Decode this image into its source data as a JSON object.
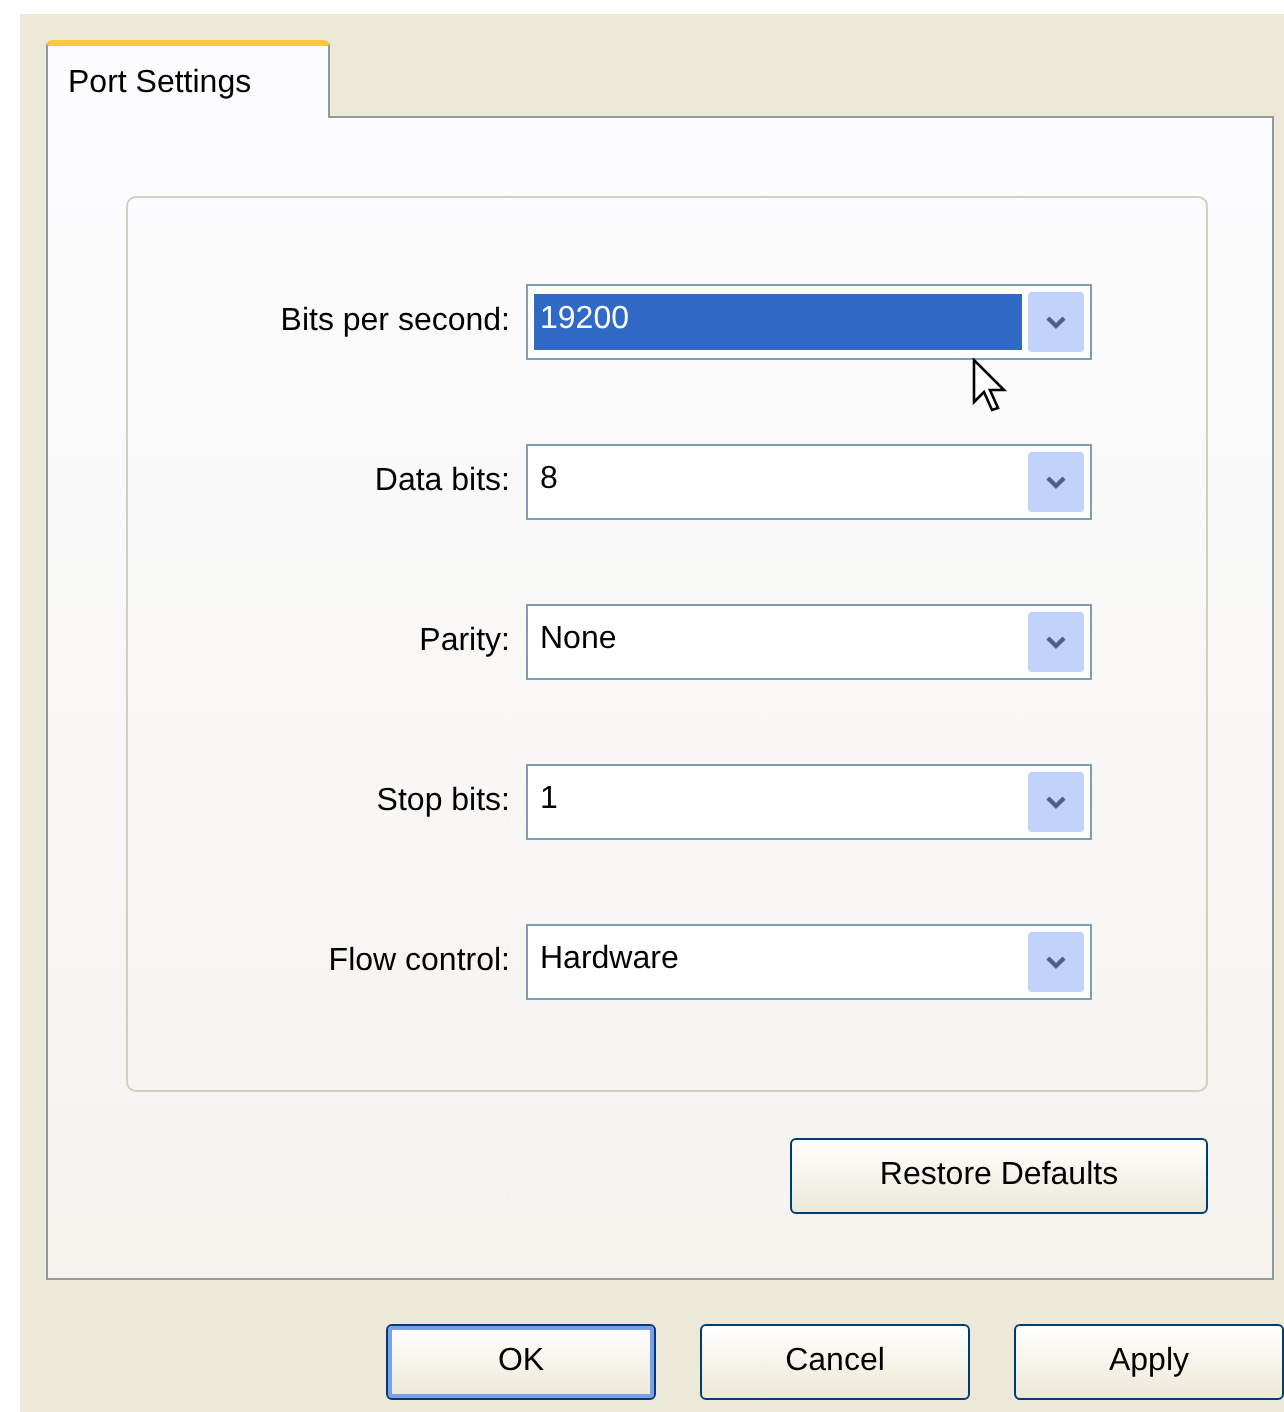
{
  "tabs": [
    {
      "label": "Port Settings",
      "selected": true
    }
  ],
  "fields": [
    {
      "label": "Bits per second:",
      "value": "19200",
      "focused": true
    },
    {
      "label": "Data bits:",
      "value": "8",
      "focused": false
    },
    {
      "label": "Parity:",
      "value": "None",
      "focused": false
    },
    {
      "label": "Stop bits:",
      "value": "1",
      "focused": false
    },
    {
      "label": "Flow control:",
      "value": "Hardware",
      "focused": false
    }
  ],
  "restore_button": "Restore Defaults",
  "buttons": [
    {
      "label": "OK",
      "default": true
    },
    {
      "label": "Cancel",
      "default": false
    },
    {
      "label": "Apply",
      "default": false
    }
  ]
}
